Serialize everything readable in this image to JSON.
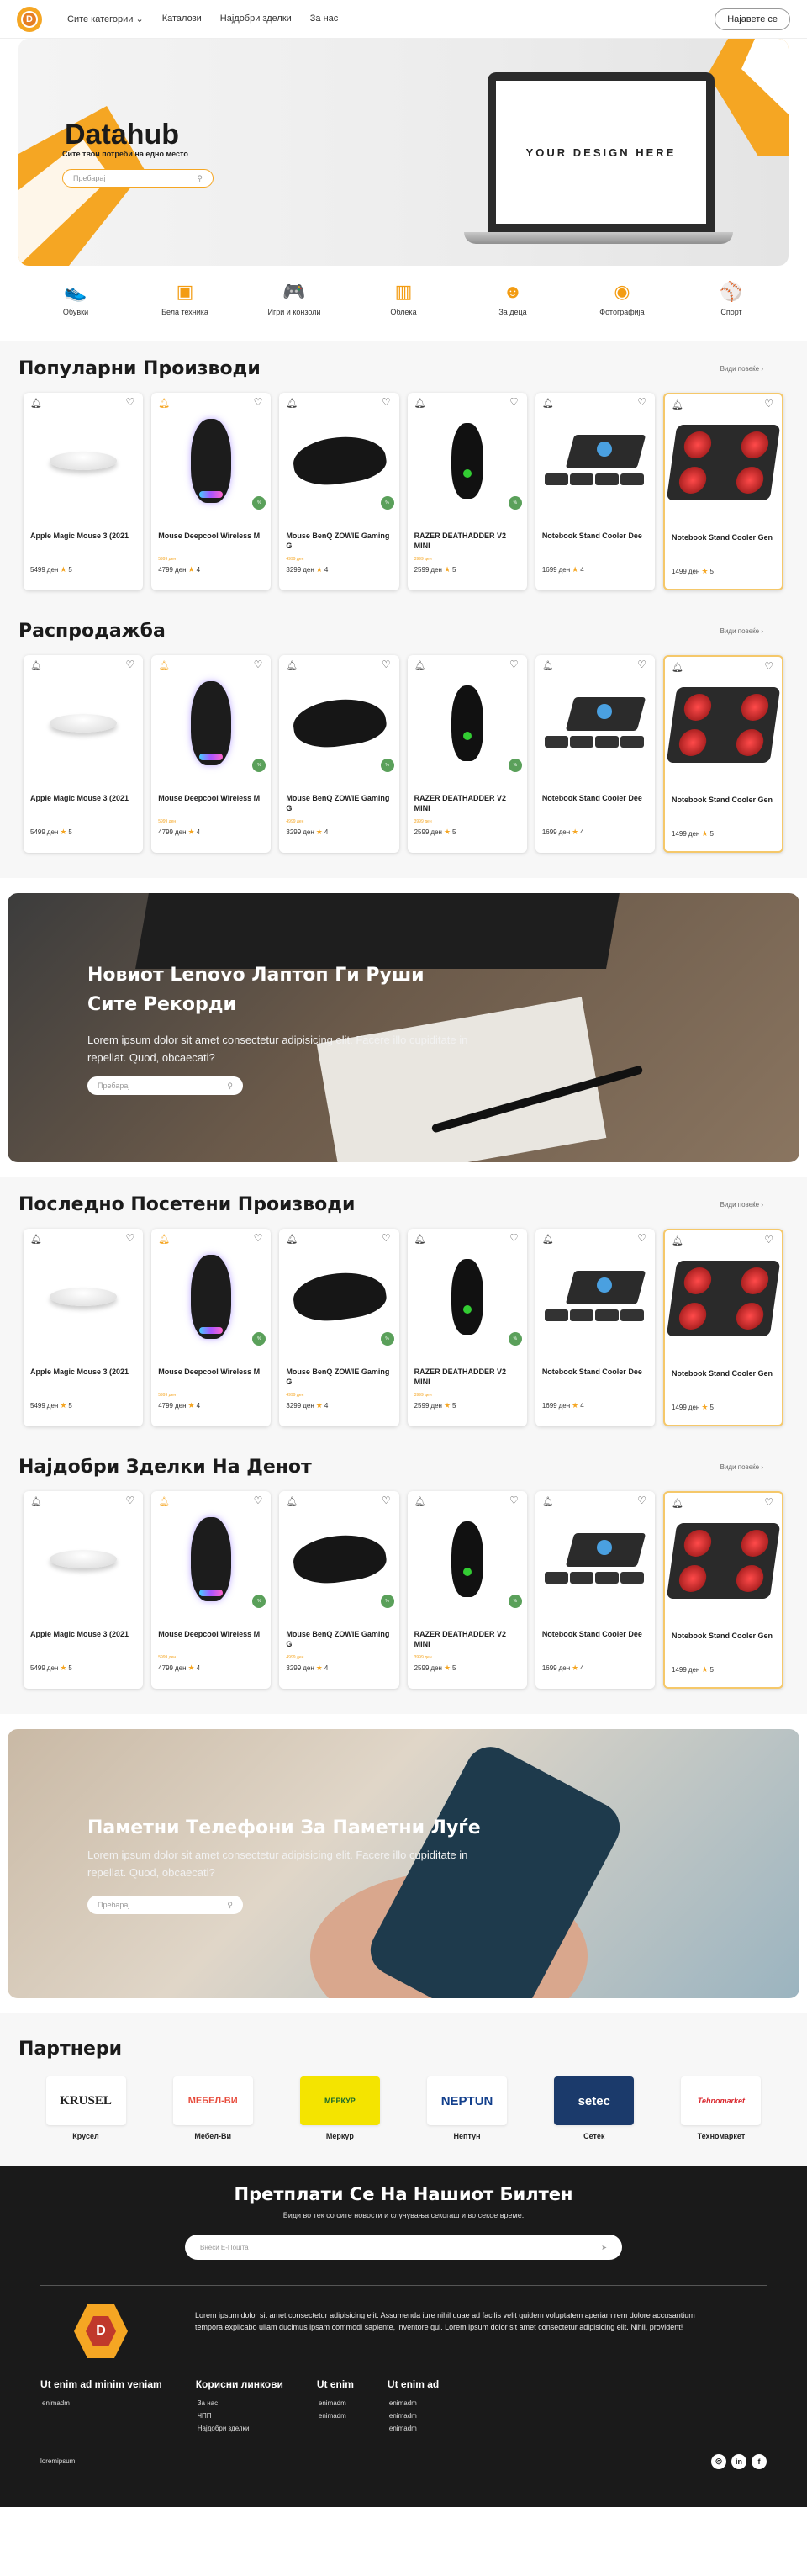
{
  "nav": {
    "logo_letter": "D",
    "links": [
      "Сите категории",
      "Каталози",
      "Најдобри зделки",
      "За нас"
    ],
    "login": "Најавете се"
  },
  "hero": {
    "title": "Datahub",
    "subtitle": "Сите твои потреби на едно место",
    "search_placeholder": "Пребарај",
    "laptop_screen_text": "YOUR DESIGN HERE"
  },
  "categories": [
    {
      "label": "Обувки",
      "icon": "shoe-icon"
    },
    {
      "label": "Бела техника",
      "icon": "appliance-icon"
    },
    {
      "label": "Игри и конзоли",
      "icon": "gamepad-icon"
    },
    {
      "label": "Облека",
      "icon": "clothing-icon"
    },
    {
      "label": "За деца",
      "icon": "baby-icon"
    },
    {
      "label": "Фотографија",
      "icon": "camera-icon"
    },
    {
      "label": "Спорт",
      "icon": "ball-icon"
    }
  ],
  "see_more": "Види повеќе",
  "currency_suffix": "ден",
  "products": [
    {
      "name": "Apple Magic Mouse 3 (2021",
      "price": "5499",
      "rating": "5",
      "tag": ""
    },
    {
      "name": "Mouse Deepcool Wireless M",
      "price": "4799",
      "rating": "4",
      "tag": "5999 ден"
    },
    {
      "name": "Mouse BenQ ZOWIE Gaming G",
      "price": "3299",
      "rating": "4",
      "tag": "4999 ден"
    },
    {
      "name": "RAZER DEATHADDER V2 MINI",
      "price": "2599",
      "rating": "5",
      "tag": "3999 ден"
    },
    {
      "name": "Notebook Stand Cooler Dee",
      "price": "1699",
      "rating": "4",
      "tag": ""
    },
    {
      "name": "Notebook Stand Cooler Gen",
      "price": "1499",
      "rating": "5",
      "tag": ""
    }
  ],
  "sections": [
    {
      "title": "Популарни Производи"
    },
    {
      "title": "Распродажба"
    },
    {
      "title": "Последно Посетени Производи"
    },
    {
      "title": "Најдобри Зделки На Денот"
    }
  ],
  "banner1": {
    "title_line1": "Новиот Lenovo Лаптоп Ги Руши",
    "title_line2": "Сите Рекорди",
    "text": "Lorem ipsum dolor sit amet consectetur adipisicing elit. Facere illo cupiditate in repellat. Quod, obcaecati?",
    "search_placeholder": "Пребарај"
  },
  "banner2": {
    "title": "Паметни Телефони За Паметни Луѓе",
    "text": "Lorem ipsum dolor sit amet consectetur adipisicing elit. Facere illo cupiditate in repellat. Quod, obcaecati?",
    "search_placeholder": "Пребарај"
  },
  "partners": {
    "title": "Партнери",
    "items": [
      {
        "name": "Крусел",
        "logo_text": "KRUSEL",
        "bg": "#ffffff",
        "fg": "#222222"
      },
      {
        "name": "Мебел-Ви",
        "logo_text": "МЕБЕЛ-ВИ",
        "bg": "#ffffff",
        "fg": "#e74c3c"
      },
      {
        "name": "Меркур",
        "logo_text": "МЕРКУР",
        "bg": "#f4e400",
        "fg": "#1a6a2a"
      },
      {
        "name": "Нептун",
        "logo_text": "NEPTUN",
        "bg": "#ffffff",
        "fg": "#123f8c"
      },
      {
        "name": "Сетек",
        "logo_text": "setec",
        "bg": "#1b3a6b",
        "fg": "#ffffff"
      },
      {
        "name": "Техномаркет",
        "logo_text": "Tehnomarket",
        "bg": "#ffffff",
        "fg": "#d9262c"
      }
    ]
  },
  "newsletter": {
    "title": "Претплати Се На Нашиот Билтен",
    "subtitle": "Биди во тек со сите новости и случувања секогаш и во секое време.",
    "placeholder": "Внеси E-Пошта"
  },
  "footer": {
    "logo_letter": "D",
    "text": "Lorem ipsum dolor sit amet consectetur adipisicing elit. Assumenda iure nihil quae ad facilis velit quidem voluptatem aperiam rem dolore accusantium tempora explicabo ullam ducimus ipsam commodi sapiente, inventore qui. Lorem ipsum dolor sit amet consectetur adipisicing elit. Nihil, provident!",
    "columns": [
      {
        "title": "Ut enim ad minim veniam",
        "items": [
          "enimadm"
        ]
      },
      {
        "title": "Корисни линкови",
        "items": [
          "За нас",
          "ЧПП",
          "Најдобри зделки"
        ]
      },
      {
        "title": "Ut enim",
        "items": [
          "enimadm",
          "enimadm"
        ]
      },
      {
        "title": "Ut enim ad",
        "items": [
          "enimadm",
          "enimadm",
          "enimadm"
        ]
      }
    ],
    "copyright": "loremipsum",
    "socials": [
      "instagram-icon",
      "linkedin-icon",
      "facebook-icon"
    ]
  },
  "colors": {
    "accent": "#f5a623",
    "dark": "#1a1a1a",
    "badge_green": "#5aa05a"
  }
}
